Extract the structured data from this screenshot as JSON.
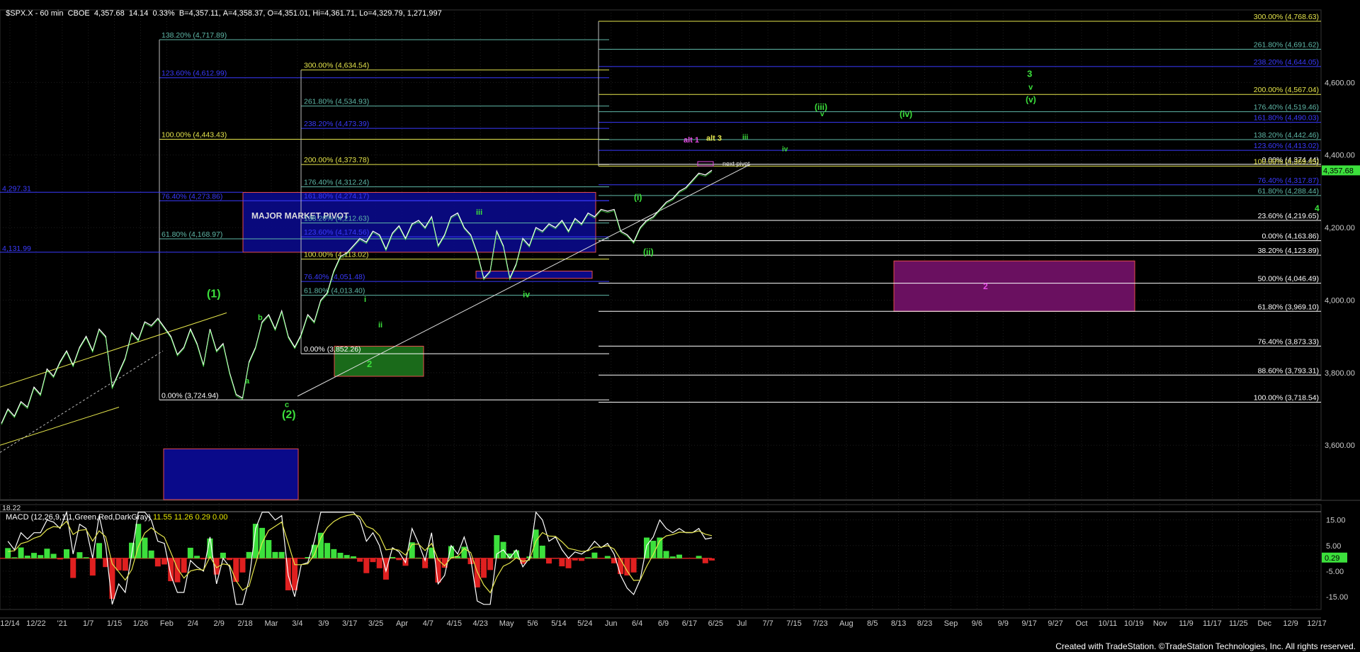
{
  "header": {
    "symbol": "$SPX.X - 60 min",
    "exchange": "CBOE",
    "last": "4,357.68",
    "change": "14.14",
    "pct": "0.33%",
    "bid": "B=4,357.11",
    "ask": "A=4,358.37",
    "open": "O=4,351.01",
    "high": "Hi=4,361.71",
    "low": "Lo=4,329.79",
    "volume": "1,271,997"
  },
  "footer": "Created with TradeStation. ©TradeStation Technologies, Inc. All rights reserved.",
  "colors": {
    "yellow": "#e6e64c",
    "teal": "#5fb8a8",
    "blue": "#3a3aff",
    "green": "#3ce03c",
    "magenta": "#e64ce6",
    "white": "#ffffff"
  },
  "chart_data": [
    {
      "type": "line",
      "title": "$SPX.X - 60 min",
      "ylim": [
        3450,
        4800
      ],
      "y_ticks": [
        "3,600.00",
        "3,800.00",
        "4,000.00",
        "4,200.00",
        "4,400.00",
        "4,600.00"
      ],
      "y_tick_values": [
        3600,
        3800,
        4000,
        4200,
        4400,
        4600
      ],
      "last_price_label": "4,357.68",
      "last_price_value": 4357.68,
      "x_tick_labels": [
        "12/14",
        "12/22",
        "'21",
        "1/7",
        "1/15",
        "1/26",
        "Feb",
        "2/4",
        "2/9",
        "2/18",
        "Mar",
        "3/4",
        "3/9",
        "3/17",
        "3/25",
        "Apr",
        "4/7",
        "4/15",
        "4/23",
        "May",
        "5/6",
        "5/14",
        "5/24",
        "Jun",
        "6/4",
        "6/9",
        "6/17",
        "6/25",
        "Jul",
        "7/7",
        "7/15",
        "7/23",
        "Aug",
        "8/5",
        "8/13",
        "8/23",
        "Sep",
        "9/6",
        "9/9",
        "9/17",
        "9/27",
        "Oct",
        "10/11",
        "10/19",
        "Nov",
        "11/9",
        "11/17",
        "11/25",
        "Dec",
        "12/9",
        "12/17"
      ],
      "price_path": [
        3660,
        3700,
        3680,
        3720,
        3705,
        3760,
        3740,
        3810,
        3790,
        3830,
        3860,
        3820,
        3870,
        3900,
        3860,
        3920,
        3900,
        3760,
        3800,
        3840,
        3910,
        3890,
        3940,
        3930,
        3950,
        3925,
        3900,
        3850,
        3870,
        3920,
        3880,
        3820,
        3920,
        3860,
        3880,
        3800,
        3740,
        3730,
        3830,
        3870,
        3940,
        3960,
        3920,
        3970,
        3900,
        3870,
        3905,
        3960,
        3940,
        4000,
        4020,
        4080,
        4120,
        4130,
        4150,
        4170,
        4160,
        4190,
        4180,
        4140,
        4185,
        4205,
        4170,
        4210,
        4220,
        4200,
        4230,
        4150,
        4180,
        4230,
        4240,
        4200,
        4180,
        4130,
        4060,
        4080,
        4190,
        4150,
        4060,
        4100,
        4170,
        4150,
        4200,
        4190,
        4210,
        4200,
        4220,
        4190,
        4225,
        4210,
        4240,
        4230,
        4250,
        4245,
        4250,
        4190,
        4180,
        4160,
        4200,
        4220,
        4230,
        4250,
        4270,
        4280,
        4300,
        4310,
        4330,
        4350,
        4345,
        4358
      ],
      "fib_levels": [
        {
          "label": "300.00% (4,768.63)",
          "value": 4768.63,
          "color": "yellow"
        },
        {
          "label": "261.80% (4,691.62)",
          "value": 4691.62,
          "color": "teal"
        },
        {
          "label": "238.20% (4,644.05)",
          "value": 4644.05,
          "color": "blue"
        },
        {
          "label": "200.00% (4,567.04)",
          "value": 4567.04,
          "color": "yellow"
        },
        {
          "label": "176.40% (4,519.46)",
          "value": 4519.46,
          "color": "teal"
        },
        {
          "label": "161.80% (4,490.03)",
          "value": 4490.03,
          "color": "blue"
        },
        {
          "label": "138.20% (4,442.46)",
          "value": 4442.46,
          "color": "teal"
        },
        {
          "label": "123.60% (4,413.02)",
          "value": 4413.02,
          "color": "blue"
        },
        {
          "label": "0.00% (4,374.44)",
          "value": 4374.44,
          "color": "white"
        },
        {
          "label": "100.00% (4,369.45)",
          "value": 4369.45,
          "color": "yellow"
        },
        {
          "label": "76.40% (4,317.87)",
          "value": 4317.87,
          "color": "blue"
        },
        {
          "label": "61.80% (4,288.44)",
          "value": 4288.44,
          "color": "teal"
        },
        {
          "label": "23.60% (4,219.65)",
          "value": 4219.65,
          "color": "white"
        },
        {
          "label": "0.00% (4,163.86)",
          "value": 4163.86,
          "color": "white"
        },
        {
          "label": "38.20% (4,123.89)",
          "value": 4123.89,
          "color": "white"
        },
        {
          "label": "50.00% (4,046.49)",
          "value": 4046.49,
          "color": "white"
        },
        {
          "label": "61.80% (3,969.10)",
          "value": 3969.1,
          "color": "white"
        },
        {
          "label": "76.40% (3,873.33)",
          "value": 3873.33,
          "color": "white"
        },
        {
          "label": "88.60% (3,793.31)",
          "value": 3793.31,
          "color": "white"
        },
        {
          "label": "100.00% (3,718.54)",
          "value": 3718.54,
          "color": "white"
        }
      ],
      "mid_fibs": [
        {
          "label": "300.00% (4,634.54)",
          "value": 4634.54,
          "color": "yellow"
        },
        {
          "label": "261.80% (4,534.93)",
          "value": 4534.93,
          "color": "teal"
        },
        {
          "label": "238.20% (4,473.39)",
          "value": 4473.39,
          "color": "blue"
        },
        {
          "label": "200.00% (4,373.78)",
          "value": 4373.78,
          "color": "yellow"
        },
        {
          "label": "176.40% (4,312.24)",
          "value": 4312.24,
          "color": "teal"
        },
        {
          "label": "161.80% (4,274.17)",
          "value": 4274.17,
          "color": "blue"
        },
        {
          "label": "138.20% (4,212.63)",
          "value": 4212.63,
          "color": "teal"
        },
        {
          "label": "123.60% (4,174.56)",
          "value": 4174.56,
          "color": "blue"
        },
        {
          "label": "100.00% (4,113.02)",
          "value": 4113.02,
          "color": "yellow"
        },
        {
          "label": "76.40% (4,051.48)",
          "value": 4051.48,
          "color": "blue"
        },
        {
          "label": "61.80% (4,013.40)",
          "value": 4013.4,
          "color": "teal"
        },
        {
          "label": "0.00% (3,852.26)",
          "value": 3852.26,
          "color": "white"
        }
      ],
      "left_fibs": [
        {
          "label": "138.20% (4,717.89)",
          "value": 4717.89,
          "color": "teal"
        },
        {
          "label": "123.60% (4,612.99)",
          "value": 4612.99,
          "color": "blue"
        },
        {
          "label": "100.00% (4,443.43)",
          "value": 4443.43,
          "color": "yellow"
        },
        {
          "label": "76.40% (4,273.86)",
          "value": 4273.86,
          "color": "blue"
        },
        {
          "label": "61.80% (4,168.97)",
          "value": 4168.97,
          "color": "teal"
        },
        {
          "label": "0.00% (3,724.94)",
          "value": 3724.94,
          "color": "white"
        }
      ],
      "edge_levels": [
        {
          "label": "4,297.31",
          "value": 4297.31
        },
        {
          "label": "4,131.99",
          "value": 4131.99
        }
      ],
      "annotations": {
        "major_pivot": "MAJOR MARKET PIVOT",
        "next_pivot": "next pivot",
        "wave_1": "(1)",
        "wave_2": "(2)",
        "a": "a",
        "b": "b",
        "c": "c",
        "i": "i",
        "ii": "ii",
        "iii": "iii",
        "iv": "iv",
        "wave_2_small": "2",
        "w_i": "(i)",
        "w_ii": "(ii)",
        "w_iii": "(iii)",
        "w_iv": "(iv)",
        "w_v": "(v)",
        "small_iii": "iii",
        "small_iv": "iv",
        "small_v": "v",
        "small_v2": "v",
        "three": "3",
        "four": "4",
        "alt1": "alt 1",
        "alt3": "alt 3",
        "magenta_2": "2"
      }
    },
    {
      "type": "line",
      "title": "MACD (12,26,9,1,1,Green,Red,DarkGray)",
      "values_shown": [
        "11.55",
        "11.26",
        "0.29",
        "0.00"
      ],
      "level_label": "18.22",
      "y_ticks": [
        "15.00",
        "5.00",
        "-5.00",
        "-15.00"
      ],
      "y_tick_values": [
        15,
        5,
        -5,
        -15
      ],
      "last_label": "0.29",
      "ylim": [
        -20,
        21
      ]
    }
  ]
}
